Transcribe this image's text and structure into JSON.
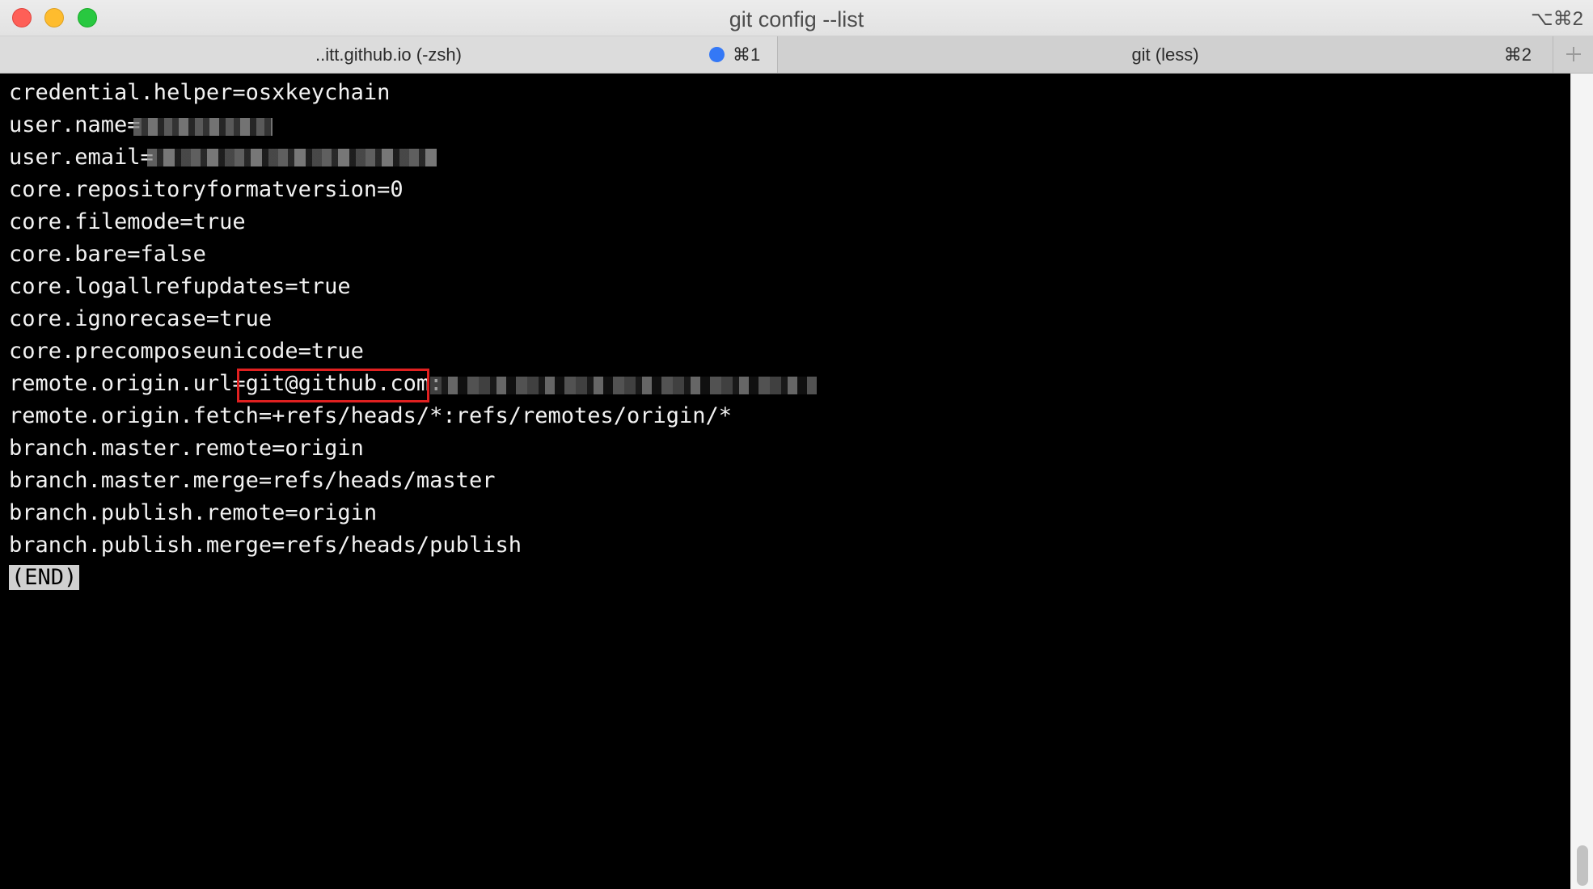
{
  "window": {
    "title": "git config --list",
    "shortcut": "⌥⌘2"
  },
  "tabs": [
    {
      "label": "..itt.github.io (-zsh)",
      "shortcut": "⌘1",
      "active": false,
      "activity_dot_color": "#3478f6"
    },
    {
      "label": "git (less)",
      "shortcut": "⌘2",
      "active": true
    }
  ],
  "new_tab_icon": "plus-icon",
  "terminal": {
    "lines": [
      "credential.helper=osxkeychain",
      "user.name=",
      "user.email=",
      "core.repositoryformatversion=0",
      "core.filemode=true",
      "core.bare=false",
      "core.logallrefupdates=true",
      "core.ignorecase=true",
      "core.precomposeunicode=true",
      "remote.origin.url=git@github.com:",
      "remote.origin.fetch=+refs/heads/*:refs/remotes/origin/*",
      "branch.master.remote=origin",
      "branch.master.merge=refs/heads/master",
      "branch.publish.remote=origin",
      "branch.publish.merge=refs/heads/publish"
    ],
    "end_marker": "(END)"
  },
  "colors": {
    "terminal_bg": "#000000",
    "terminal_fg": "#f2f2f2",
    "highlight_box": "#e02020",
    "end_marker_bg": "#d0d0d0"
  }
}
